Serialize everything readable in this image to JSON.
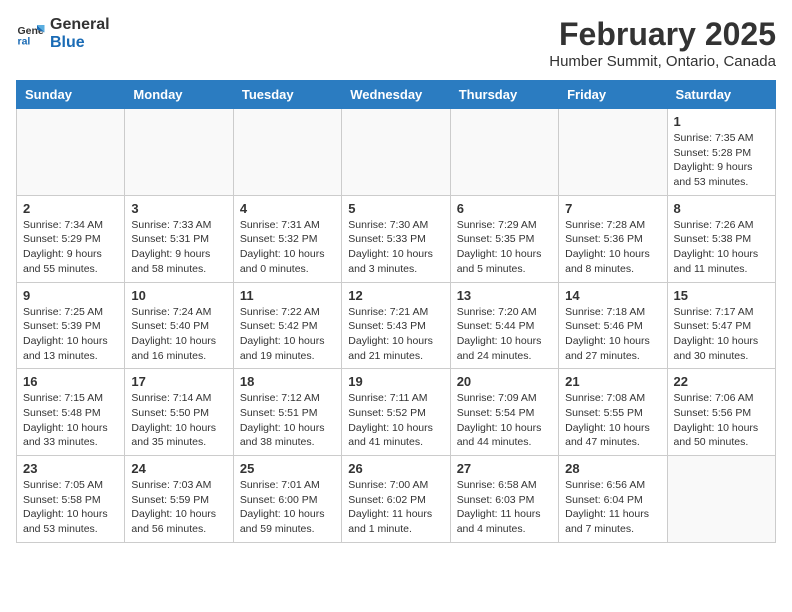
{
  "header": {
    "logo_line1": "General",
    "logo_line2": "Blue",
    "title": "February 2025",
    "subtitle": "Humber Summit, Ontario, Canada"
  },
  "days_of_week": [
    "Sunday",
    "Monday",
    "Tuesday",
    "Wednesday",
    "Thursday",
    "Friday",
    "Saturday"
  ],
  "weeks": [
    [
      {
        "day": "",
        "info": ""
      },
      {
        "day": "",
        "info": ""
      },
      {
        "day": "",
        "info": ""
      },
      {
        "day": "",
        "info": ""
      },
      {
        "day": "",
        "info": ""
      },
      {
        "day": "",
        "info": ""
      },
      {
        "day": "1",
        "info": "Sunrise: 7:35 AM\nSunset: 5:28 PM\nDaylight: 9 hours and 53 minutes."
      }
    ],
    [
      {
        "day": "2",
        "info": "Sunrise: 7:34 AM\nSunset: 5:29 PM\nDaylight: 9 hours and 55 minutes."
      },
      {
        "day": "3",
        "info": "Sunrise: 7:33 AM\nSunset: 5:31 PM\nDaylight: 9 hours and 58 minutes."
      },
      {
        "day": "4",
        "info": "Sunrise: 7:31 AM\nSunset: 5:32 PM\nDaylight: 10 hours and 0 minutes."
      },
      {
        "day": "5",
        "info": "Sunrise: 7:30 AM\nSunset: 5:33 PM\nDaylight: 10 hours and 3 minutes."
      },
      {
        "day": "6",
        "info": "Sunrise: 7:29 AM\nSunset: 5:35 PM\nDaylight: 10 hours and 5 minutes."
      },
      {
        "day": "7",
        "info": "Sunrise: 7:28 AM\nSunset: 5:36 PM\nDaylight: 10 hours and 8 minutes."
      },
      {
        "day": "8",
        "info": "Sunrise: 7:26 AM\nSunset: 5:38 PM\nDaylight: 10 hours and 11 minutes."
      }
    ],
    [
      {
        "day": "9",
        "info": "Sunrise: 7:25 AM\nSunset: 5:39 PM\nDaylight: 10 hours and 13 minutes."
      },
      {
        "day": "10",
        "info": "Sunrise: 7:24 AM\nSunset: 5:40 PM\nDaylight: 10 hours and 16 minutes."
      },
      {
        "day": "11",
        "info": "Sunrise: 7:22 AM\nSunset: 5:42 PM\nDaylight: 10 hours and 19 minutes."
      },
      {
        "day": "12",
        "info": "Sunrise: 7:21 AM\nSunset: 5:43 PM\nDaylight: 10 hours and 21 minutes."
      },
      {
        "day": "13",
        "info": "Sunrise: 7:20 AM\nSunset: 5:44 PM\nDaylight: 10 hours and 24 minutes."
      },
      {
        "day": "14",
        "info": "Sunrise: 7:18 AM\nSunset: 5:46 PM\nDaylight: 10 hours and 27 minutes."
      },
      {
        "day": "15",
        "info": "Sunrise: 7:17 AM\nSunset: 5:47 PM\nDaylight: 10 hours and 30 minutes."
      }
    ],
    [
      {
        "day": "16",
        "info": "Sunrise: 7:15 AM\nSunset: 5:48 PM\nDaylight: 10 hours and 33 minutes."
      },
      {
        "day": "17",
        "info": "Sunrise: 7:14 AM\nSunset: 5:50 PM\nDaylight: 10 hours and 35 minutes."
      },
      {
        "day": "18",
        "info": "Sunrise: 7:12 AM\nSunset: 5:51 PM\nDaylight: 10 hours and 38 minutes."
      },
      {
        "day": "19",
        "info": "Sunrise: 7:11 AM\nSunset: 5:52 PM\nDaylight: 10 hours and 41 minutes."
      },
      {
        "day": "20",
        "info": "Sunrise: 7:09 AM\nSunset: 5:54 PM\nDaylight: 10 hours and 44 minutes."
      },
      {
        "day": "21",
        "info": "Sunrise: 7:08 AM\nSunset: 5:55 PM\nDaylight: 10 hours and 47 minutes."
      },
      {
        "day": "22",
        "info": "Sunrise: 7:06 AM\nSunset: 5:56 PM\nDaylight: 10 hours and 50 minutes."
      }
    ],
    [
      {
        "day": "23",
        "info": "Sunrise: 7:05 AM\nSunset: 5:58 PM\nDaylight: 10 hours and 53 minutes."
      },
      {
        "day": "24",
        "info": "Sunrise: 7:03 AM\nSunset: 5:59 PM\nDaylight: 10 hours and 56 minutes."
      },
      {
        "day": "25",
        "info": "Sunrise: 7:01 AM\nSunset: 6:00 PM\nDaylight: 10 hours and 59 minutes."
      },
      {
        "day": "26",
        "info": "Sunrise: 7:00 AM\nSunset: 6:02 PM\nDaylight: 11 hours and 1 minute."
      },
      {
        "day": "27",
        "info": "Sunrise: 6:58 AM\nSunset: 6:03 PM\nDaylight: 11 hours and 4 minutes."
      },
      {
        "day": "28",
        "info": "Sunrise: 6:56 AM\nSunset: 6:04 PM\nDaylight: 11 hours and 7 minutes."
      },
      {
        "day": "",
        "info": ""
      }
    ]
  ]
}
